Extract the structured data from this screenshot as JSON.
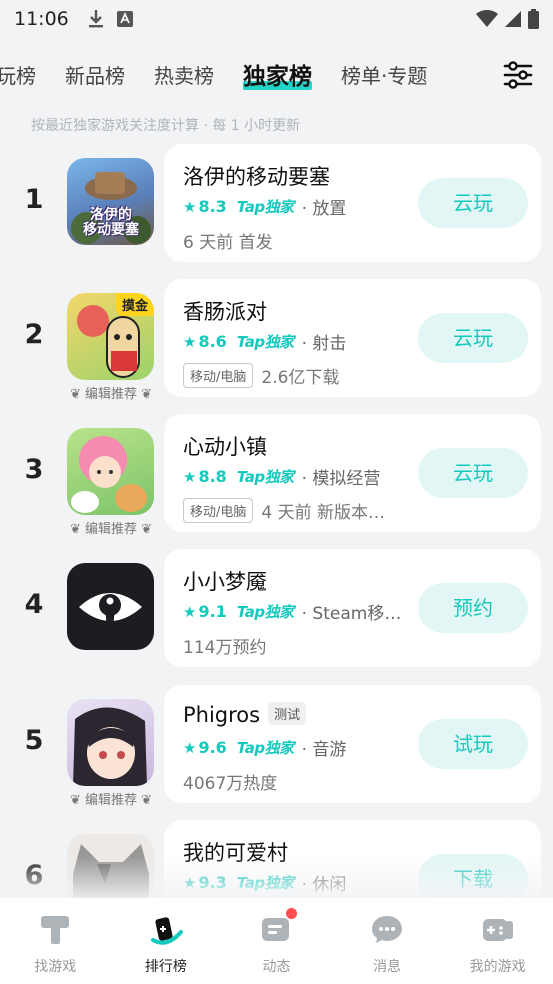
{
  "status_bar": {
    "time": "11:06"
  },
  "tabs": [
    {
      "label": "玩榜",
      "active": false
    },
    {
      "label": "新品榜",
      "active": false
    },
    {
      "label": "热卖榜",
      "active": false
    },
    {
      "label": "独家榜",
      "active": true
    },
    {
      "label": "榜单·专题",
      "active": false
    }
  ],
  "subtitle": "按最近独家游戏关注度计算 · 每 1 小时更新",
  "editor_pick_label": "编辑推荐",
  "games": [
    {
      "rank": "1",
      "name": "洛伊的移动要塞",
      "score": "8.3",
      "tap_label": "Tap独家",
      "genre": "放置",
      "platform": "",
      "info": "6 天前 首发",
      "button": "云玩",
      "badge": "",
      "test_tag": "",
      "icon_text": "洛伊的 移动要塞"
    },
    {
      "rank": "2",
      "name": "香肠派对",
      "score": "8.6",
      "tap_label": "Tap独家",
      "genre": "射击",
      "platform": "移动/电脑",
      "info": "2.6亿下载",
      "button": "云玩",
      "badge": "摸金",
      "test_tag": "",
      "icon_text": ""
    },
    {
      "rank": "3",
      "name": "心动小镇",
      "score": "8.8",
      "tap_label": "Tap独家",
      "genre": "模拟经营",
      "platform": "移动/电脑",
      "info": "4 天前 新版本…",
      "button": "云玩",
      "badge": "",
      "test_tag": "",
      "icon_text": ""
    },
    {
      "rank": "4",
      "name": "小小梦魇",
      "score": "9.1",
      "tap_label": "Tap独家",
      "genre": "Steam移…",
      "platform": "",
      "info": "114万预约",
      "button": "预约",
      "badge": "",
      "test_tag": "",
      "icon_text": ""
    },
    {
      "rank": "5",
      "name": "Phigros",
      "score": "9.6",
      "tap_label": "Tap独家",
      "genre": "音游",
      "platform": "",
      "info": "4067万热度",
      "button": "试玩",
      "badge": "",
      "test_tag": "测试",
      "icon_text": ""
    },
    {
      "rank": "6",
      "name": "我的可爱村",
      "score": "9.3",
      "tap_label": "Tap独家",
      "genre": "休闲",
      "platform": "",
      "info": "",
      "button": "下载",
      "badge": "",
      "test_tag": "",
      "icon_text": ""
    }
  ],
  "bottom_nav": [
    {
      "label": "找游戏",
      "icon": "hammer-icon",
      "active": false
    },
    {
      "label": "排行榜",
      "icon": "ranking-icon",
      "active": true
    },
    {
      "label": "动态",
      "icon": "feed-icon",
      "active": false
    },
    {
      "label": "消息",
      "icon": "chat-bubble-icon",
      "active": false
    },
    {
      "label": "我的游戏",
      "icon": "gamepad-icon",
      "active": false
    }
  ],
  "colors": {
    "accent": "#14c9bd",
    "tab_highlight": "#25d4c9",
    "button_bg": "#e2f7f5",
    "notification_dot": "#ff4d4f"
  }
}
